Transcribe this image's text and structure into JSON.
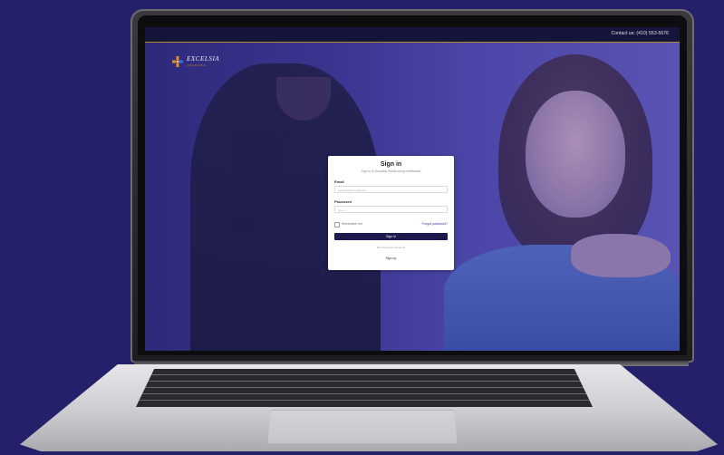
{
  "topbar": {
    "contact_text": "Contact us: (410) 553-5676"
  },
  "brand": {
    "name": "EXCELSIA",
    "tagline": "INSURANCE"
  },
  "signin": {
    "title": "Sign in",
    "subtitle": "Sign in to Excelsia Portal using credentials",
    "email_label": "Email",
    "email_placeholder": "example@excelsia.com",
    "password_label": "Password",
    "password_placeholder": "••••••••",
    "remember_label": "Remember me",
    "forgot_label": "Forgot password?",
    "submit_label": "Sign in",
    "no_account_text": "Don't have an account?",
    "signup_label": "Sign up"
  },
  "colors": {
    "background": "#25206a",
    "topbar": "#15143a",
    "topbar_accent": "#b58a2a",
    "button": "#1c1a4e",
    "logo_orange": "#e08a22",
    "logo_blue": "#3a6fd8"
  }
}
